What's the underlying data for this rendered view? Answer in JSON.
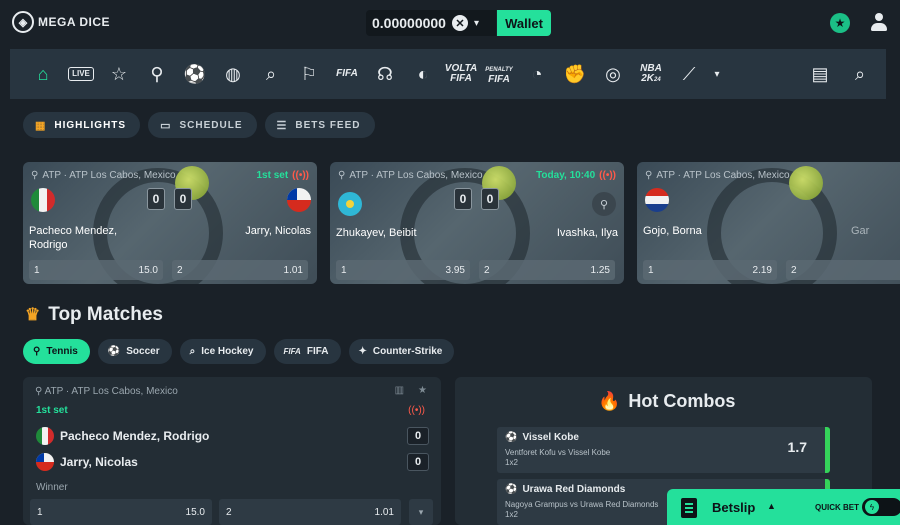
{
  "header": {
    "logo_text": "MEGA DICE",
    "balance": "0.00000000",
    "wallet_label": "Wallet"
  },
  "sport_nav": {
    "live_label": "LIVE",
    "fifa_label": "FIFA",
    "volta_label": "VOLTA",
    "penalty_label": "PENALTY",
    "nba_label": "NBA",
    "badge_24": "24"
  },
  "tabs": [
    {
      "label": "HIGHLIGHTS",
      "icon": "grid-icon"
    },
    {
      "label": "SCHEDULE",
      "icon": "calendar-icon"
    },
    {
      "label": "BETS FEED",
      "icon": "list-icon"
    }
  ],
  "highlight_cards": [
    {
      "league": "ATP · ATP Los Cabos, Mexico",
      "status": "1st set",
      "home": "Pacheco Mendez, Rodrigo",
      "away": "Jarry, Nicolas",
      "home_score": "0",
      "away_score": "0",
      "odds": [
        {
          "label": "1",
          "value": "15.0"
        },
        {
          "label": "2",
          "value": "1.01"
        }
      ]
    },
    {
      "league": "ATP · ATP Los Cabos, Mexico",
      "status": "Today, 10:40",
      "home": "Zhukayev, Beibit",
      "away": "Ivashka, Ilya",
      "home_score": "0",
      "away_score": "0",
      "odds": [
        {
          "label": "1",
          "value": "3.95"
        },
        {
          "label": "2",
          "value": "1.25"
        }
      ]
    },
    {
      "league": "ATP · ATP Los Cabos, Mexico",
      "home": "Gojo, Borna",
      "away_partial": "Gar",
      "odds": [
        {
          "label": "1",
          "value": "2.19"
        },
        {
          "label": "2",
          "value": ""
        }
      ]
    }
  ],
  "top_matches": {
    "title": "Top Matches",
    "sports": [
      {
        "label": "Tennis",
        "active": true
      },
      {
        "label": "Soccer"
      },
      {
        "label": "Ice Hockey"
      },
      {
        "label": "FIFA"
      },
      {
        "label": "Counter-Strike"
      }
    ],
    "match": {
      "league": "ATP · ATP Los Cabos, Mexico",
      "status": "1st set",
      "home": "Pacheco Mendez, Rodrigo",
      "away": "Jarry, Nicolas",
      "home_score": "0",
      "away_score": "0",
      "market": "Winner",
      "odds": [
        {
          "label": "1",
          "value": "15.0"
        },
        {
          "label": "2",
          "value": "1.01"
        }
      ]
    }
  },
  "hot_combos": {
    "title": "Hot Combos",
    "items": [
      {
        "team": "Vissel Kobe",
        "match": "Ventforet Kofu vs Vissel Kobe",
        "bet": "1x2",
        "odds": "1.7"
      },
      {
        "team": "Urawa Red Diamonds",
        "match": "Nagoya Grampus vs Urawa Red Diamonds",
        "bet": "1x2",
        "odds": ""
      }
    ]
  },
  "betslip": {
    "label": "Betslip",
    "quick_bet_label": "QUICK BET"
  },
  "colors": {
    "accent": "#24e09b",
    "live": "#ff5a4a",
    "highlight": "#f5a524"
  }
}
